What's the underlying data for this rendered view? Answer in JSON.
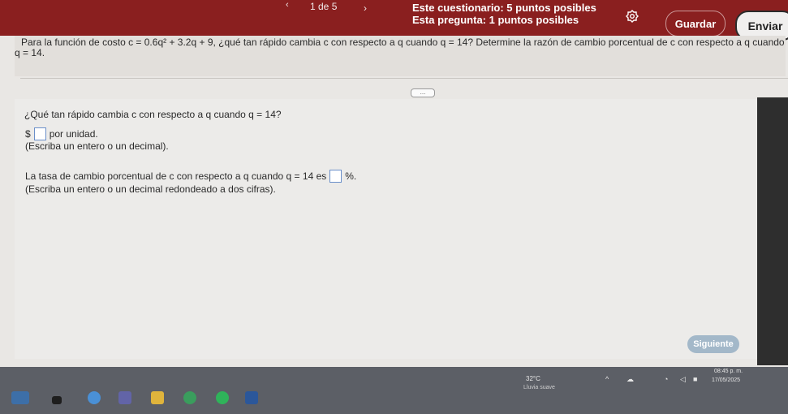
{
  "header": {
    "page_indicator": "1 de 5",
    "quiz_points": "Este cuestionario: 5 puntos posibles",
    "question_points": "Esta pregunta: 1 puntos posibles",
    "save_label": "Guardar",
    "submit_label": "Enviar",
    "prev_icon": "chevron-left-icon",
    "next_icon": "chevron-right-icon",
    "settings_icon": "gear-icon"
  },
  "question": {
    "line1": "Para la función de costo c = 0.6q² + 3.2q + 9,  ¿qué tan rápido cambia c con respecto a q cuando q = 14? Determine la razón de cambio porcentual de c con respecto a q cuando",
    "line2": "q = 14."
  },
  "answer": {
    "prompt": "¿Qué tan rápido cambia c con respecto a q cuando q = 14?",
    "currency": "$",
    "unit": "por unidad.",
    "hint1": "(Escriba un entero o un decimal).",
    "rate_prefix": "La tasa de cambio porcentual de c con respecto a q cuando q = 14 es",
    "rate_suffix": "%.",
    "hint2": "(Escriba un entero o un decimal redondeado a dos cifras).",
    "more_label": "..."
  },
  "footer": {
    "next_label": "Siguiente"
  },
  "taskbar": {
    "temperature": "32°C",
    "weather": "Lluvia suave",
    "time": "08:45 p. m.",
    "date": "17/05/2025"
  }
}
